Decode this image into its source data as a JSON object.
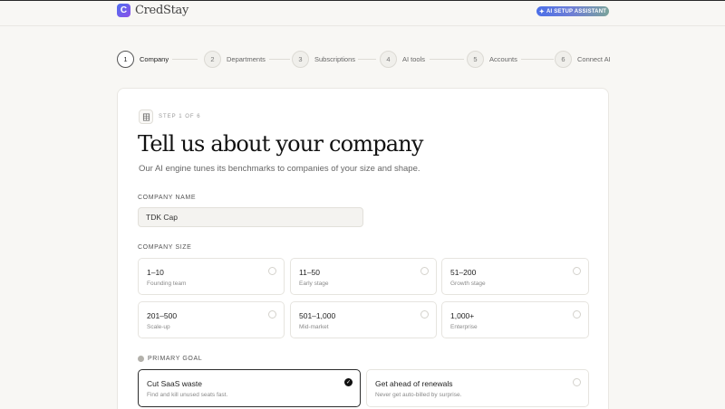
{
  "app": {
    "logo_letter": "C",
    "name": "CredStay",
    "ai_badge": "AI SETUP ASSISTANT"
  },
  "colors": {
    "accent": "#4f6ff0",
    "brand_gradient_end": "#8c4fe8",
    "selected_border": "#2c2c2c"
  },
  "steps": [
    {
      "num": "1",
      "label": "Company",
      "active": true
    },
    {
      "num": "2",
      "label": "Departments"
    },
    {
      "num": "3",
      "label": "Subscriptions"
    },
    {
      "num": "4",
      "label": "AI tools"
    },
    {
      "num": "5",
      "label": "Accounts"
    },
    {
      "num": "6",
      "label": "Connect AI"
    }
  ],
  "card": {
    "eyebrow_icon": "building-icon",
    "eyebrow": "STEP 1 OF 6",
    "title": "Tell us about your company",
    "subtitle": "Our AI engine tunes its benchmarks to companies of your size and shape."
  },
  "company_name": {
    "label": "COMPANY NAME",
    "value": "TDK Cap",
    "placeholder": ""
  },
  "company_size": {
    "label": "COMPANY SIZE",
    "options": [
      {
        "title": "1–10",
        "sub": "Founding team"
      },
      {
        "title": "11–50",
        "sub": "Early stage"
      },
      {
        "title": "51–200",
        "sub": "Growth stage"
      },
      {
        "title": "201–500",
        "sub": "Scale-up"
      },
      {
        "title": "501–1,000",
        "sub": "Mid-market"
      },
      {
        "title": "1,000+",
        "sub": "Enterprise"
      }
    ]
  },
  "primary_goal": {
    "label": "PRIMARY GOAL",
    "options": [
      {
        "title": "Cut SaaS waste",
        "sub": "Find and kill unused seats fast.",
        "selected": true,
        "check": "✓"
      },
      {
        "title": "Get ahead of renewals",
        "sub": "Never get auto-billed by surprise.",
        "selected": false
      }
    ]
  }
}
